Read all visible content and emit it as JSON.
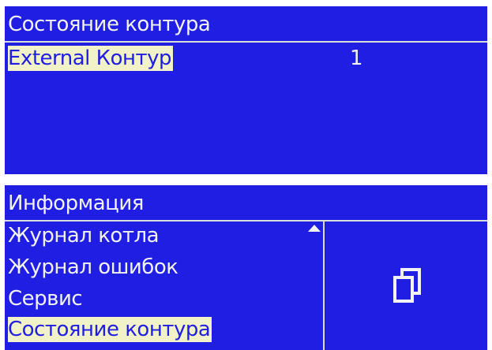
{
  "screen1": {
    "title": "Состояние контура",
    "rows": [
      {
        "label": "External Контур",
        "value": "1",
        "selected": true
      }
    ]
  },
  "screen2": {
    "title": "Информация",
    "menu_items": [
      {
        "label": "Журнал котла",
        "selected": false
      },
      {
        "label": "Журнал ошибок",
        "selected": false
      },
      {
        "label": "Сервис",
        "selected": false
      },
      {
        "label": "Состояние контура",
        "selected": true
      }
    ],
    "scroll_indicator_icon": "scroll-up-arrow-icon",
    "panel_icon": "copy-pages-icon"
  },
  "colors": {
    "background": "#1f1ee2",
    "text": "#f2f2f2",
    "highlight_bg": "#f2f2c8",
    "divider": "#dcdcdc"
  }
}
